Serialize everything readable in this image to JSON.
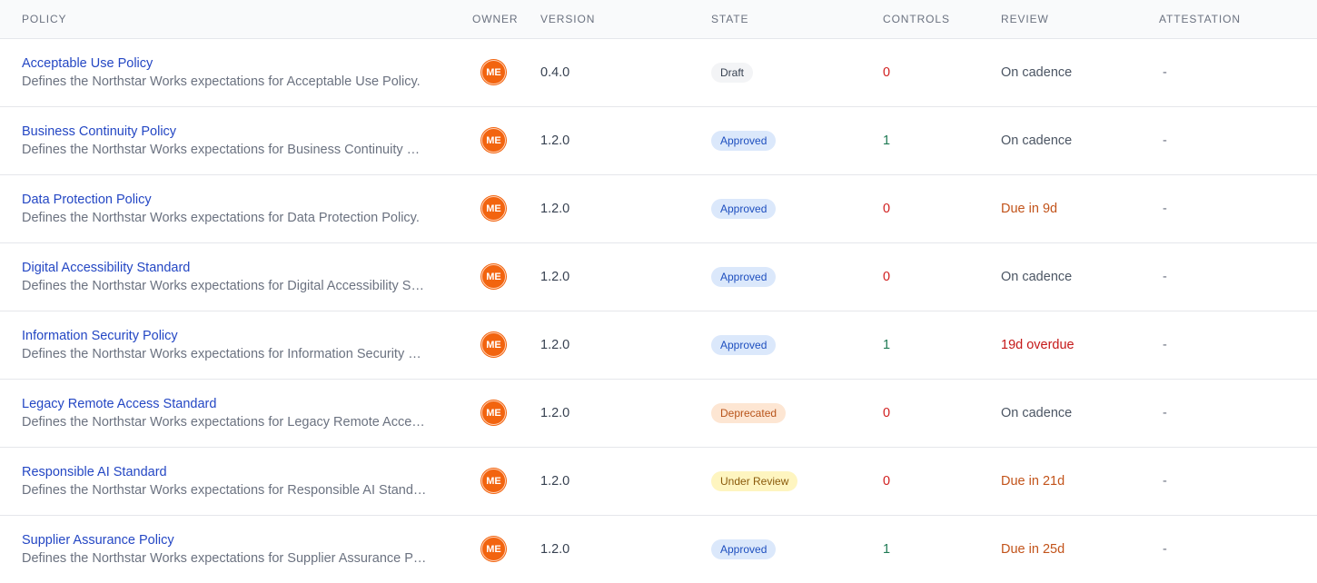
{
  "columns": {
    "policy": "POLICY",
    "owner": "OWNER",
    "version": "VERSION",
    "state": "STATE",
    "controls": "CONTROLS",
    "review": "REVIEW",
    "attestation": "ATTESTATION"
  },
  "rows": [
    {
      "name": "Acceptable Use Policy",
      "description": "Defines the Northstar Works expectations for Acceptable Use Policy.",
      "owner": "ME",
      "version": "0.4.0",
      "state": "Draft",
      "state_kind": "draft",
      "controls": "0",
      "controls_kind": "zero",
      "review": "On cadence",
      "review_kind": "cadence",
      "attestation": "-"
    },
    {
      "name": "Business Continuity Policy",
      "description": "Defines the Northstar Works expectations for Business Continuity Policy.",
      "owner": "ME",
      "version": "1.2.0",
      "state": "Approved",
      "state_kind": "approved",
      "controls": "1",
      "controls_kind": "positive",
      "review": "On cadence",
      "review_kind": "cadence",
      "attestation": "-"
    },
    {
      "name": "Data Protection Policy",
      "description": "Defines the Northstar Works expectations for Data Protection Policy.",
      "owner": "ME",
      "version": "1.2.0",
      "state": "Approved",
      "state_kind": "approved",
      "controls": "0",
      "controls_kind": "zero",
      "review": "Due in 9d",
      "review_kind": "due",
      "attestation": "-"
    },
    {
      "name": "Digital Accessibility Standard",
      "description": "Defines the Northstar Works expectations for Digital Accessibility Standard.",
      "owner": "ME",
      "version": "1.2.0",
      "state": "Approved",
      "state_kind": "approved",
      "controls": "0",
      "controls_kind": "zero",
      "review": "On cadence",
      "review_kind": "cadence",
      "attestation": "-"
    },
    {
      "name": "Information Security Policy",
      "description": "Defines the Northstar Works expectations for Information Security Policy.",
      "owner": "ME",
      "version": "1.2.0",
      "state": "Approved",
      "state_kind": "approved",
      "controls": "1",
      "controls_kind": "positive",
      "review": "19d overdue",
      "review_kind": "overdue",
      "attestation": "-"
    },
    {
      "name": "Legacy Remote Access Standard",
      "description": "Defines the Northstar Works expectations for Legacy Remote Access Standard.",
      "owner": "ME",
      "version": "1.2.0",
      "state": "Deprecated",
      "state_kind": "deprecated",
      "controls": "0",
      "controls_kind": "zero",
      "review": "On cadence",
      "review_kind": "cadence",
      "attestation": "-"
    },
    {
      "name": "Responsible AI Standard",
      "description": "Defines the Northstar Works expectations for Responsible AI Standard.",
      "owner": "ME",
      "version": "1.2.0",
      "state": "Under Review",
      "state_kind": "review",
      "controls": "0",
      "controls_kind": "zero",
      "review": "Due in 21d",
      "review_kind": "due",
      "attestation": "-"
    },
    {
      "name": "Supplier Assurance Policy",
      "description": "Defines the Northstar Works expectations for Supplier Assurance Policy.",
      "owner": "ME",
      "version": "1.2.0",
      "state": "Approved",
      "state_kind": "approved",
      "controls": "1",
      "controls_kind": "positive",
      "review": "Due in 25d",
      "review_kind": "due",
      "attestation": "-"
    }
  ],
  "colors": {
    "link": "#2447c4",
    "avatar": "#f2640f",
    "controls_zero": "#d11f1f",
    "controls_positive": "#1f7a54",
    "review_due": "#c2531a",
    "review_overdue": "#c51818"
  }
}
